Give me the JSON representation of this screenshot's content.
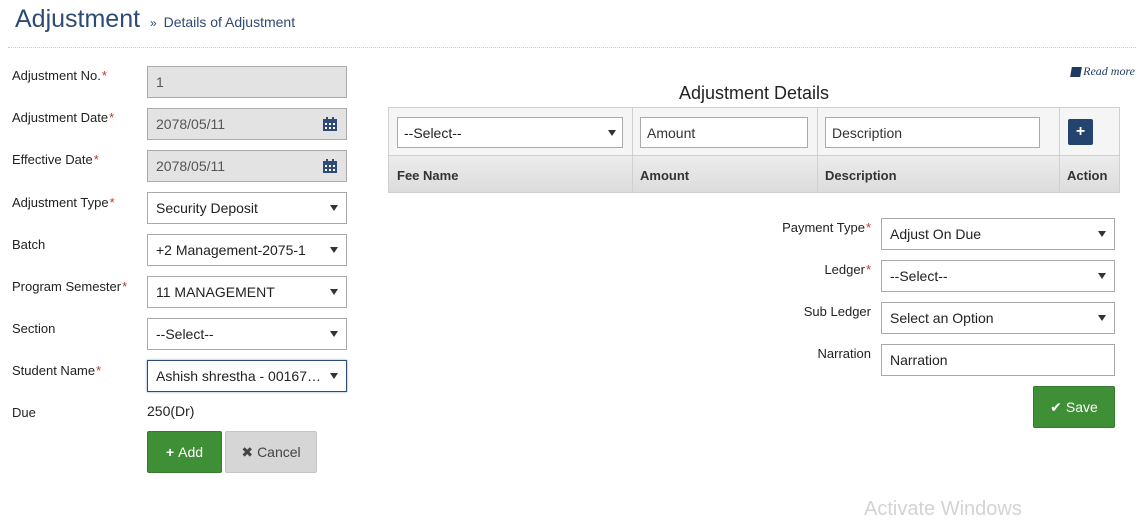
{
  "header": {
    "title": "Adjustment",
    "breadcrumb_sep": "»",
    "breadcrumb": "Details of Adjustment"
  },
  "form": {
    "adjustment_no": {
      "label": "Adjustment No.",
      "value": "1"
    },
    "adjustment_date": {
      "label": "Adjustment Date",
      "value": "2078/05/11"
    },
    "effective_date": {
      "label": "Effective Date",
      "value": "2078/05/11"
    },
    "adjustment_type": {
      "label": "Adjustment Type",
      "value": "Security Deposit"
    },
    "batch": {
      "label": "Batch",
      "value": "+2 Management-2075-1"
    },
    "program_semester": {
      "label": "Program Semester",
      "value": "11 MANAGEMENT"
    },
    "section": {
      "label": "Section",
      "value": "--Select--"
    },
    "student_name": {
      "label": "Student Name",
      "value": "Ashish shrestha - 001675..."
    },
    "due": {
      "label": "Due",
      "value": "250(Dr)"
    },
    "required_mark": "*",
    "add_button": "Add",
    "cancel_button": "Cancel"
  },
  "details": {
    "read_more": "Read more",
    "title": "Adjustment Details",
    "select_value": "--Select--",
    "amount_placeholder": "Amount",
    "description_placeholder": "Description",
    "add_row_button": "+",
    "columns": [
      "Fee Name",
      "Amount",
      "Description",
      "Action"
    ]
  },
  "payment": {
    "payment_type": {
      "label": "Payment Type",
      "value": "Adjust On Due"
    },
    "ledger": {
      "label": "Ledger",
      "value": "--Select--"
    },
    "sub_ledger": {
      "label": "Sub Ledger",
      "value": "Select an Option"
    },
    "narration": {
      "label": "Narration",
      "placeholder": "Narration"
    },
    "save_button": "Save"
  },
  "watermark": "Activate Windows",
  "colors": {
    "title": "#2d4b75",
    "primary_button": "#3f8f36",
    "add_row_button": "#23446f",
    "required": "#c0392b"
  },
  "icons": [
    "calendar-icon",
    "plus-icon",
    "times-icon",
    "check-icon",
    "book-icon",
    "caret-down-icon"
  ]
}
